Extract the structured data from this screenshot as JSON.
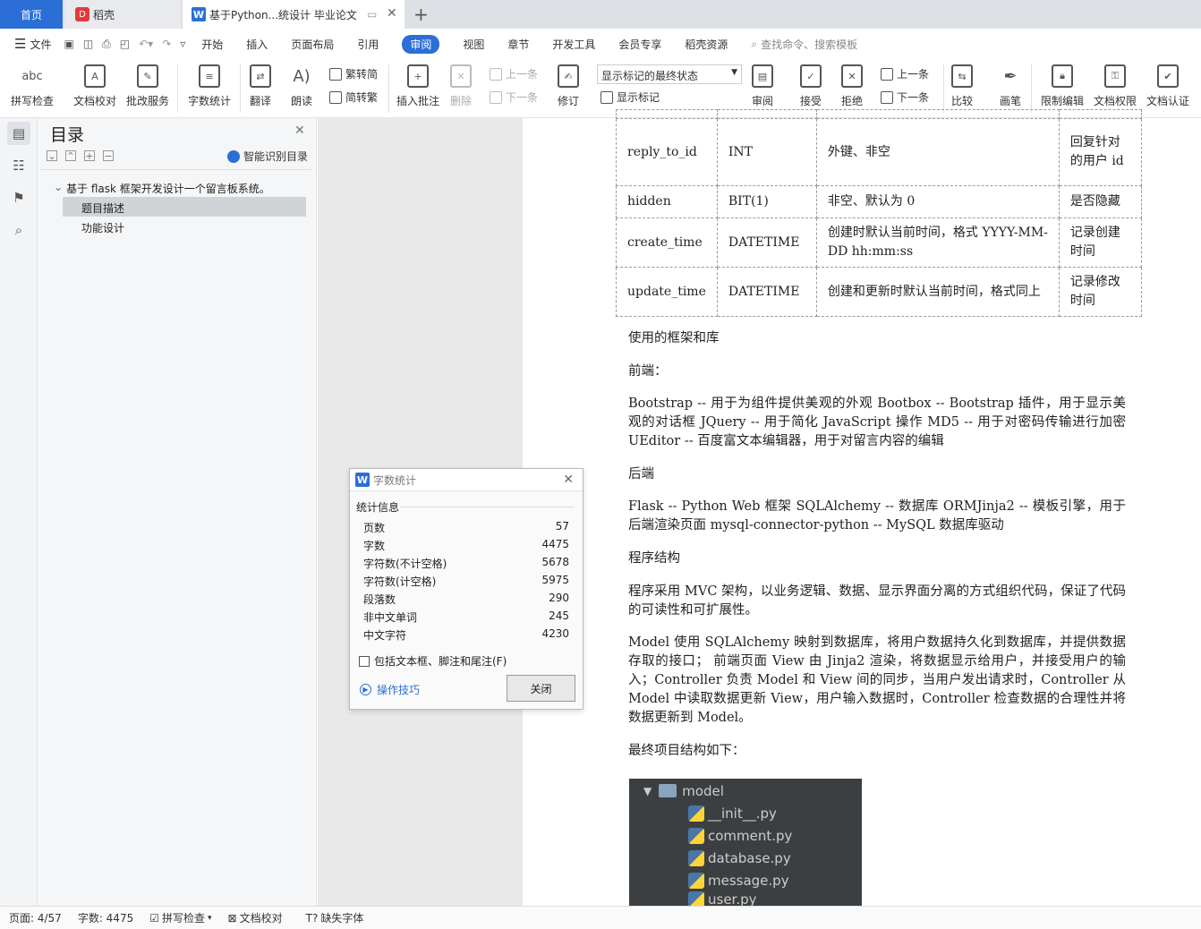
{
  "tabs": {
    "home": "首页",
    "daoke": "稻壳",
    "doc": "基于Python...统设计 毕业论文"
  },
  "menu": {
    "file": "文件",
    "items": [
      "开始",
      "插入",
      "页面布局",
      "引用",
      "审阅",
      "视图",
      "章节",
      "开发工具",
      "会员专享",
      "稻壳资源"
    ],
    "active": "审阅",
    "search_placeholder": "查找命令、搜索模板"
  },
  "ribbon": {
    "spell": "拼写检查",
    "proof": "文档校对",
    "correct": "批改服务",
    "wordcount": "字数统计",
    "translate": "翻译",
    "read": "朗读",
    "t2s": "繁转简",
    "s2t": "简转繁",
    "insert_comment": "插入批注",
    "delete": "删除",
    "prev": "上一条",
    "next": "下一条",
    "track": "修订",
    "markup_select": "显示标记的最终状态",
    "show_markup": "显示标记",
    "review": "审阅",
    "accept": "接受",
    "reject": "拒绝",
    "prev2": "上一条",
    "next2": "下一条",
    "compare": "比较",
    "pen": "画笔",
    "restrict": "限制编辑",
    "rights": "文档权限",
    "cert": "文档认证"
  },
  "toc": {
    "title": "目录",
    "smart": "智能识别目录",
    "items": [
      "基于 flask 框架开发设计一个留言板系统。",
      "题目描述",
      "功能设计"
    ]
  },
  "table": {
    "rows": [
      [
        "reply_to_id",
        "INT",
        "外键、非空",
        "回复针对的用户 id"
      ],
      [
        "hidden",
        "BIT(1)",
        "非空、默认为 0",
        "是否隐藏"
      ],
      [
        "create_time",
        "DATETIME",
        "创建时默认当前时间，格式 YYYY-MM-DD hh:mm:ss",
        "记录创建时间"
      ],
      [
        "update_time",
        "DATETIME",
        "创建和更新时默认当前时间，格式同上",
        "记录修改时间"
      ]
    ]
  },
  "content": {
    "p1": "使用的框架和库",
    "p2": "前端：",
    "p3": "Bootstrap   -- 用于为组件提供美观的外观 Bootbox   -- Bootstrap 插件，用于显示美观的对话框 JQuery   -- 用于简化 JavaScript 操作 MD5   -- 用于对密码传输进行加密 UEditor   -- 百度富文本编辑器，用于对留言内容的编辑",
    "p4": "后端",
    "p5": "Flask   -- Python Web 框架 SQLAlchemy   -- 数据库 ORMJinja2   -- 模板引擎，用于后端渲染页面 mysql-connector-python   -- MySQL 数据库驱动",
    "p6": "程序结构",
    "p7": "程序采用 MVC 架构，以业务逻辑、数据、显示界面分离的方式组织代码，保证了代码的可读性和可扩展性。",
    "p8": "Model 使用 SQLAlchemy 映射到数据库，将用户数据持久化到数据库，并提供数据存取的接口； 前端页面 View 由 Jinja2 渲染，将数据显示给用户，并接受用户的输入；Controller 负责 Model 和 View 间的同步，当用户发出请求时，Controller 从 Model 中读取数据更新 View，用户输入数据时，Controller 检查数据的合理性并将数据更新到 Model。",
    "p9": "最终项目结构如下："
  },
  "tree": {
    "folder": "model",
    "files": [
      "__init__.py",
      "comment.py",
      "database.py",
      "message.py",
      "user.py"
    ]
  },
  "dialog": {
    "title": "字数统计",
    "section": "统计信息",
    "stats": [
      {
        "label": "页数",
        "value": "57"
      },
      {
        "label": "字数",
        "value": "4475"
      },
      {
        "label": "字符数(不计空格)",
        "value": "5678"
      },
      {
        "label": "字符数(计空格)",
        "value": "5975"
      },
      {
        "label": "段落数",
        "value": "290"
      },
      {
        "label": "非中文单词",
        "value": "245"
      },
      {
        "label": "中文字符",
        "value": "4230"
      }
    ],
    "checkbox": "包括文本框、脚注和尾注(F)",
    "tips": "操作技巧",
    "close": "关闭"
  },
  "status": {
    "page": "页面: 4/57",
    "words": "字数: 4475",
    "spell": "拼写检查",
    "proof": "文档校对",
    "font": "缺失字体"
  }
}
